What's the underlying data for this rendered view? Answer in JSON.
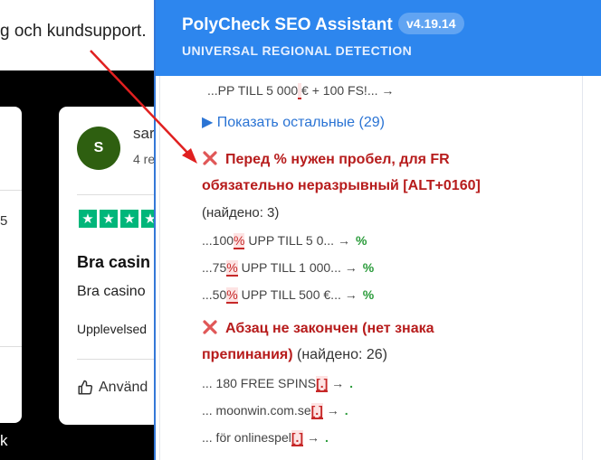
{
  "background": {
    "top_text": "g och kundsupport.",
    "left_card_digit": "5",
    "left_glyph": "k",
    "review": {
      "avatar_letter": "S",
      "name": "sar",
      "sub": "4 re",
      "stars": [
        "★",
        "★",
        "★",
        "★",
        "★"
      ],
      "title": "Bra casin",
      "body": "Bra casino",
      "experience": "Upplevelsed",
      "useful": "Använd"
    }
  },
  "panel": {
    "title": "PolyCheck SEO Assistant",
    "version": "v4.19.14",
    "subtitle": "UNIVERSAL REGIONAL DETECTION",
    "prev_item": {
      "before": "...PP TILL 5 000",
      "mark": " ",
      "after": "€ + 100 FS!... →"
    },
    "show_more": "▶ Показать остальные (29)",
    "section1": {
      "title_line1": "Перед % нужен пробел, для FR",
      "title_line2": "обязательно неразрывный [ALT+0160]",
      "found": "(найдено: 3)",
      "items": [
        {
          "before": "...100",
          "mark": "%",
          "after": " UPP TILL 5 0... →",
          "fix": "%"
        },
        {
          "before": "...75",
          "mark": "%",
          "after": " UPP TILL 1 000... →",
          "fix": "%"
        },
        {
          "before": "...50",
          "mark": "%",
          "after": " UPP TILL 500 €... →",
          "fix": "%"
        }
      ]
    },
    "section2": {
      "title_line1": "Абзац не закончен (нет знака",
      "title_line2": "препинания)",
      "found": "(найдено: 26)",
      "items": [
        {
          "before": "... 180 FREE SPINS",
          "mark": "[.]",
          "after": " →",
          "fix": "."
        },
        {
          "before": "... moonwin.com.se",
          "mark": "[.]",
          "after": " →",
          "fix": "."
        },
        {
          "before": "... för onlinespel",
          "mark": "[.]",
          "after": " →",
          "fix": "."
        }
      ]
    }
  },
  "colors": {
    "header_blue": "#2d86ee",
    "error_red": "#b71c1c",
    "link_blue": "#2b74d4",
    "ok_green": "#2a9b3a",
    "star_green": "#00b67a",
    "avatar_green": "#2e5f10"
  }
}
